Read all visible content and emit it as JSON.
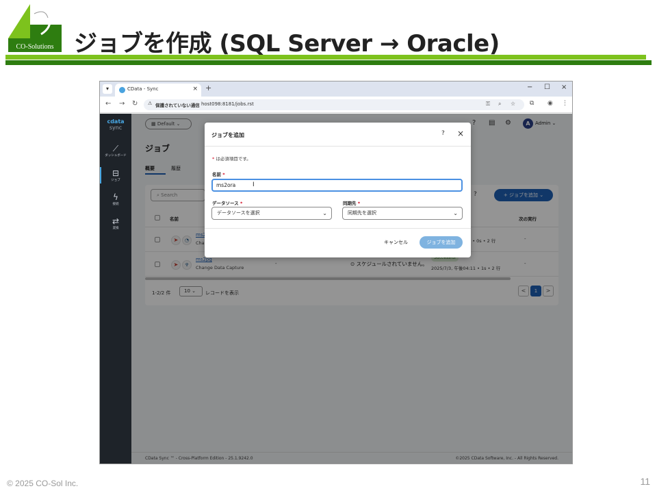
{
  "slide": {
    "title": "ジョブを作成 (SQL Server → Oracle)",
    "logo_text": "CO-Solutions",
    "copyright": "© 2025 CO-Sol Inc.",
    "page_number": "11",
    "colors": {
      "accent_green": "#7dc21d",
      "dark_green": "#2e7d10"
    }
  },
  "browser": {
    "tab_title": "CData - Sync",
    "tab_close": "×",
    "new_tab": "+",
    "window_controls": [
      "−",
      "☐",
      "×"
    ],
    "security_warning": "保護されていない通信",
    "url": "host098:8181/jobs.rst",
    "icons": [
      "back-icon",
      "forward-icon",
      "reload-icon",
      "key-icon",
      "zoom-icon",
      "star-icon",
      "extensions-icon",
      "profile-icon",
      "menu-icon"
    ]
  },
  "app": {
    "brand_line1": "cdata",
    "brand_line2": "sync",
    "sidebar": [
      {
        "icon": "chart-icon",
        "label": "ダッシュボード"
      },
      {
        "icon": "briefcase-icon",
        "label": "ジョブ",
        "active": true
      },
      {
        "icon": "bolt-icon",
        "label": "接続"
      },
      {
        "icon": "transform-icon",
        "label": "変換"
      }
    ],
    "workspace": "Default",
    "user": {
      "initial": "A",
      "name": "Admin"
    },
    "page_title": "ジョブ",
    "sub_tabs": [
      "概要",
      "履歴"
    ],
    "search_placeholder": "Search",
    "add_job_button": "+ ジョブを追加",
    "table": {
      "headers": [
        "名前",
        "次の実行"
      ],
      "rows": [
        {
          "name": "ms2...",
          "type": "Cha...",
          "run_tail": "5 • 0s • 2 行",
          "next_run": "-"
        },
        {
          "name": "ms2pg",
          "type": "Change Data Capture",
          "target_dash": "-",
          "schedule": "スケジュールされていません。",
          "status": "Successful",
          "last_run": "2025/7/3, 午後04:11 • 1s • 2 行",
          "next_run": "-"
        }
      ]
    },
    "pager": {
      "count": "1-2/2 件",
      "page_size": "10",
      "page_size_label": "レコードを表示",
      "current_page": "1",
      "prev": "<",
      "next": ">"
    },
    "footer_left": "CData Sync ™ - Cross-Platform Edition - 25.1.9242.0",
    "footer_right": "©2025 CData Software, Inc. - All Rights Reserved."
  },
  "modal": {
    "title": "ジョブを追加",
    "required_note": "は必須項目です。",
    "required_mark": "*",
    "name_label": "名前",
    "name_value": "ms2ora",
    "datasource_label": "データソース",
    "datasource_placeholder": "データソースを選択",
    "destination_label": "同期先",
    "destination_placeholder": "同期先を選択",
    "cancel_label": "キャンセル",
    "submit_label": "ジョブを追加"
  }
}
